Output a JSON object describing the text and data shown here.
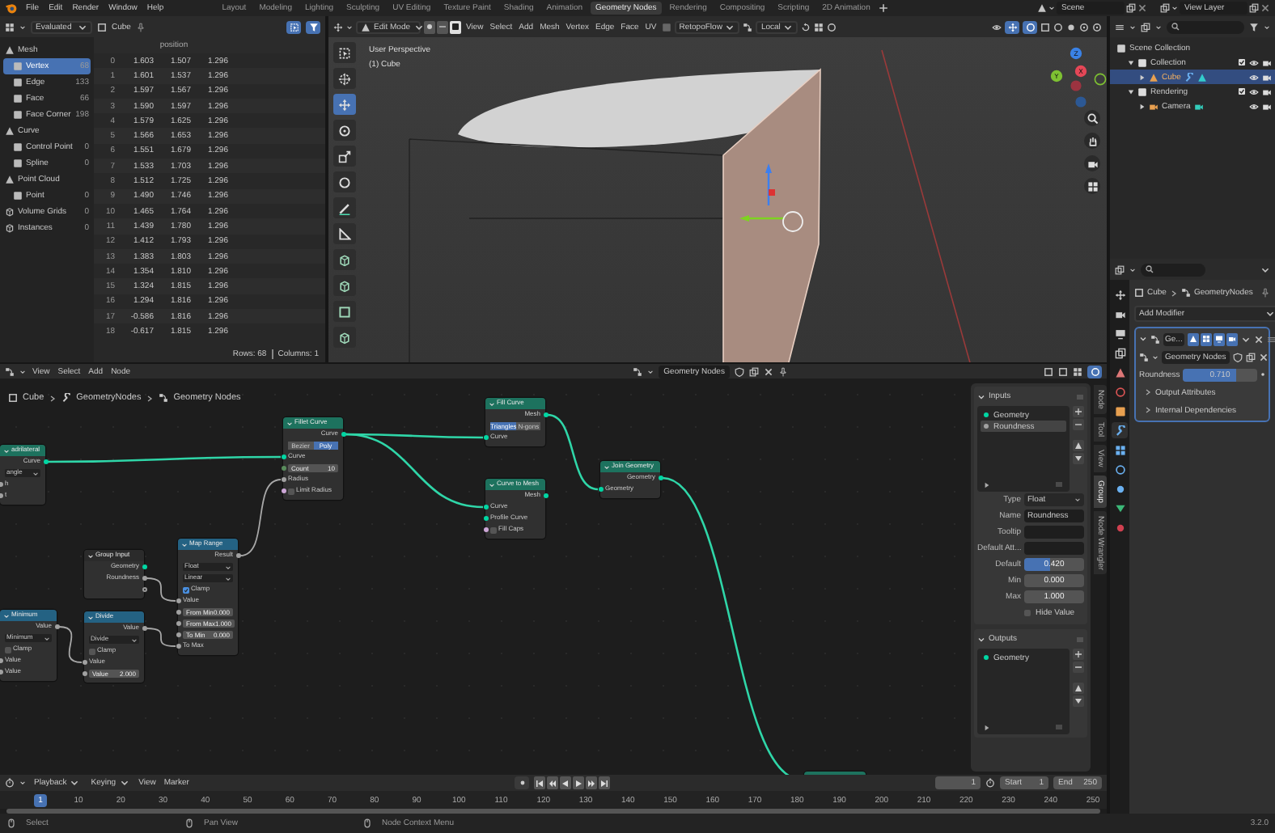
{
  "menubar": {
    "menus": [
      "File",
      "Edit",
      "Render",
      "Window",
      "Help"
    ],
    "workspaces": [
      {
        "label": "Layout",
        "selected": false
      },
      {
        "label": "Modeling",
        "selected": false
      },
      {
        "label": "Lighting",
        "selected": false
      },
      {
        "label": "Sculpting",
        "selected": false
      },
      {
        "label": "UV Editing",
        "selected": false
      },
      {
        "label": "Texture Paint",
        "selected": false
      },
      {
        "label": "Shading",
        "selected": false
      },
      {
        "label": "Animation",
        "selected": false
      },
      {
        "label": "Geometry Nodes",
        "selected": true
      },
      {
        "label": "Rendering",
        "selected": false
      },
      {
        "label": "Compositing",
        "selected": false
      },
      {
        "label": "Scripting",
        "selected": false
      },
      {
        "label": "2D Animation",
        "selected": false
      }
    ],
    "scene": "Scene",
    "view_layer": "View Layer"
  },
  "spreadsheet": {
    "mode": "Evaluated",
    "object": "Cube",
    "domains": [
      {
        "label": "Mesh",
        "children": [
          {
            "label": "Vertex",
            "count": "68",
            "selected": true
          },
          {
            "label": "Edge",
            "count": "133",
            "selected": false
          },
          {
            "label": "Face",
            "count": "66",
            "selected": false
          },
          {
            "label": "Face Corner",
            "count": "198",
            "selected": false
          }
        ]
      },
      {
        "label": "Curve",
        "children": [
          {
            "label": "Control Point",
            "count": "0",
            "selected": false
          },
          {
            "label": "Spline",
            "count": "0",
            "selected": false
          }
        ]
      },
      {
        "label": "Point Cloud",
        "children": [
          {
            "label": "Point",
            "count": "0",
            "selected": false
          }
        ]
      },
      {
        "label": "Volume Grids",
        "count": "0",
        "selected": false
      },
      {
        "label": "Instances",
        "count": "0",
        "selected": false
      }
    ],
    "column": "position",
    "rows": [
      [
        "0",
        "1.603",
        "1.507",
        "1.296"
      ],
      [
        "1",
        "1.601",
        "1.537",
        "1.296"
      ],
      [
        "2",
        "1.597",
        "1.567",
        "1.296"
      ],
      [
        "3",
        "1.590",
        "1.597",
        "1.296"
      ],
      [
        "4",
        "1.579",
        "1.625",
        "1.296"
      ],
      [
        "5",
        "1.566",
        "1.653",
        "1.296"
      ],
      [
        "6",
        "1.551",
        "1.679",
        "1.296"
      ],
      [
        "7",
        "1.533",
        "1.703",
        "1.296"
      ],
      [
        "8",
        "1.512",
        "1.725",
        "1.296"
      ],
      [
        "9",
        "1.490",
        "1.746",
        "1.296"
      ],
      [
        "10",
        "1.465",
        "1.764",
        "1.296"
      ],
      [
        "11",
        "1.439",
        "1.780",
        "1.296"
      ],
      [
        "12",
        "1.412",
        "1.793",
        "1.296"
      ],
      [
        "13",
        "1.383",
        "1.803",
        "1.296"
      ],
      [
        "14",
        "1.354",
        "1.810",
        "1.296"
      ],
      [
        "15",
        "1.324",
        "1.815",
        "1.296"
      ],
      [
        "16",
        "1.294",
        "1.816",
        "1.296"
      ],
      [
        "17",
        "-0.586",
        "1.816",
        "1.296"
      ],
      [
        "18",
        "-0.617",
        "1.815",
        "1.296"
      ]
    ],
    "rows_count": "Rows: 68",
    "columns_count": "Columns: 1"
  },
  "viewport": {
    "mode": "Edit Mode",
    "select_modes": [
      {
        "selected": false
      },
      {
        "selected": false
      },
      {
        "selected": true
      }
    ],
    "menus": [
      "View",
      "Select",
      "Add",
      "Mesh",
      "Vertex",
      "Edge",
      "Face",
      "UV"
    ],
    "addon": "RetopoFlow",
    "orientation": "Local",
    "overlay": [
      "User Perspective",
      "(1) Cube"
    ],
    "tools": [
      {
        "selected": false
      },
      {
        "selected": false
      },
      {
        "selected": true
      },
      {
        "selected": false
      },
      {
        "selected": false
      },
      {
        "selected": false
      },
      {
        "selected": false
      },
      {
        "selected": false
      },
      {
        "selected": false
      },
      {
        "selected": false
      },
      {
        "selected": false
      },
      {
        "selected": false
      }
    ],
    "axes": [
      "Z",
      "X",
      "Y"
    ]
  },
  "node_editor": {
    "menus": [
      "View",
      "Select",
      "Add",
      "Node"
    ],
    "node_group": "Geometry Nodes",
    "breadcrumb": [
      "Cube",
      "GeometryNodes",
      "Geometry Nodes"
    ],
    "nodes": [
      {
        "title": "adrilateral",
        "color": "#1d725e",
        "rows": [
          {
            "kind": "output",
            "label": "Curve",
            "color": "#00d6a3"
          },
          {
            "kind": "dropdown",
            "value": "angle"
          },
          {
            "kind": "input",
            "label": "h",
            "color": "#a1a1a1"
          },
          {
            "kind": "input",
            "label": "t",
            "color": "#a1a1a1"
          }
        ]
      },
      {
        "title": "Fillet Curve",
        "color": "#1d725e",
        "rows": [
          {
            "kind": "output",
            "label": "Curve",
            "color": "#00d6a3"
          },
          {
            "kind": "toggle",
            "options": [
              {
                "label": "Bezier",
                "selected": false
              },
              {
                "label": "Poly",
                "selected": true
              }
            ]
          },
          {
            "kind": "input",
            "label": "Curve",
            "color": "#00d6a3"
          },
          {
            "kind": "field",
            "label": "Count",
            "value": "10",
            "color": "#598c5c"
          },
          {
            "kind": "input",
            "label": "Radius",
            "color": "#a1a1a1"
          },
          {
            "kind": "checkbox",
            "label": "Limit Radius",
            "checked": false,
            "color": "#cca6d6"
          }
        ]
      },
      {
        "title": "Fill Curve",
        "color": "#1d725e",
        "rows": [
          {
            "kind": "output",
            "label": "Mesh",
            "color": "#00d6a3"
          },
          {
            "kind": "toggle",
            "options": [
              {
                "label": "Triangles",
                "selected": true
              },
              {
                "label": "N-gons",
                "selected": false
              }
            ]
          },
          {
            "kind": "input",
            "label": "Curve",
            "color": "#00d6a3"
          }
        ]
      },
      {
        "title": "Curve to Mesh",
        "color": "#1d725e",
        "rows": [
          {
            "kind": "output",
            "label": "Mesh",
            "color": "#00d6a3"
          },
          {
            "kind": "input",
            "label": "Curve",
            "color": "#00d6a3"
          },
          {
            "kind": "input",
            "label": "Profile Curve",
            "color": "#00d6a3"
          },
          {
            "kind": "checkbox",
            "label": "Fill Caps",
            "checked": false,
            "color": "#cca6d6"
          }
        ]
      },
      {
        "title": "Join Geometry",
        "color": "#1d725e",
        "rows": [
          {
            "kind": "output",
            "label": "Geometry",
            "color": "#00d6a3"
          },
          {
            "kind": "input",
            "label": "Geometry",
            "color": "#00d6a3"
          }
        ]
      },
      {
        "title": "Group Input",
        "color": "#2b2b2b",
        "rows": [
          {
            "kind": "output",
            "label": "Geometry",
            "color": "#00d6a3"
          },
          {
            "kind": "output",
            "label": "Roundness",
            "color": "#a1a1a1"
          },
          {
            "kind": "output"
          }
        ]
      },
      {
        "title": "Map Range",
        "color": "#246283",
        "rows": [
          {
            "kind": "output",
            "label": "Result",
            "color": "#a1a1a1"
          },
          {
            "kind": "dropdown",
            "value": "Float"
          },
          {
            "kind": "dropdown",
            "value": "Linear"
          },
          {
            "kind": "checkbox",
            "label": "Clamp",
            "checked": true
          },
          {
            "kind": "input",
            "label": "Value",
            "color": "#a1a1a1"
          },
          {
            "kind": "field",
            "label": "From Min",
            "value": "0.000",
            "color": "#a1a1a1"
          },
          {
            "kind": "field",
            "label": "From Max",
            "value": "1.000",
            "color": "#a1a1a1"
          },
          {
            "kind": "field",
            "label": "To Min",
            "value": "0.000",
            "color": "#a1a1a1"
          },
          {
            "kind": "input",
            "label": "To Max",
            "color": "#a1a1a1"
          }
        ]
      },
      {
        "title": "Minimum",
        "color": "#246283",
        "rows": [
          {
            "kind": "output",
            "label": "Value",
            "color": "#a1a1a1"
          },
          {
            "kind": "dropdown",
            "value": "Minimum"
          },
          {
            "kind": "checkbox",
            "label": "Clamp",
            "checked": false
          },
          {
            "kind": "input",
            "label": "Value",
            "color": "#a1a1a1"
          },
          {
            "kind": "input",
            "label": "Value",
            "color": "#a1a1a1"
          }
        ]
      },
      {
        "title": "Divide",
        "color": "#246283",
        "rows": [
          {
            "kind": "output",
            "label": "Value",
            "color": "#a1a1a1"
          },
          {
            "kind": "dropdown",
            "value": "Divide"
          },
          {
            "kind": "checkbox",
            "label": "Clamp",
            "checked": false
          },
          {
            "kind": "input",
            "label": "Value",
            "color": "#a1a1a1"
          },
          {
            "kind": "field",
            "label": "Value",
            "value": "2.000",
            "color": "#a1a1a1"
          }
        ]
      },
      {
        "color": "#1d725e"
      }
    ]
  },
  "group_panel": {
    "tabs": [
      {
        "label": "Node",
        "selected": false
      },
      {
        "label": "Tool",
        "selected": false
      },
      {
        "label": "View",
        "selected": false
      },
      {
        "label": "Group",
        "selected": true
      },
      {
        "label": "Node Wrangler",
        "selected": false
      }
    ],
    "inputs": {
      "title": "Inputs",
      "expanded": true,
      "items": [
        {
          "label": "Geometry",
          "selected": false,
          "color": "#00d6a3"
        },
        {
          "label": "Roundness",
          "selected": true,
          "color": "#a1a1a1"
        }
      ]
    },
    "fields": [
      {
        "kind": "dropdown",
        "label": "Type",
        "value": "Float"
      },
      {
        "kind": "text",
        "label": "Name",
        "value": "Roundness"
      },
      {
        "kind": "text",
        "label": "Tooltip"
      },
      {
        "kind": "text",
        "label": "Default Att..."
      },
      {
        "kind": "slider",
        "label": "Default",
        "value": "0.420",
        "level": 0.42
      },
      {
        "kind": "number",
        "label": "Min",
        "value": "0.000"
      },
      {
        "kind": "number",
        "label": "Max",
        "value": "1.000"
      },
      {
        "kind": "checkbox",
        "label": "Hide Value",
        "checked": false
      }
    ],
    "outputs": {
      "title": "Outputs",
      "expanded": true,
      "items": [
        {
          "label": "Geometry",
          "selected": false,
          "color": "#00d6a3"
        }
      ]
    }
  },
  "outliner": {
    "items": [
      {
        "label": "Scene Collection",
        "kind": "scene",
        "selected": false,
        "children": [
          {
            "label": "Collection",
            "kind": "collection",
            "expanded": true,
            "selected": false,
            "children": [
              {
                "label": "Cube",
                "kind": "object",
                "expanded": false,
                "selected": true
              }
            ]
          },
          {
            "label": "Rendering",
            "kind": "collection",
            "expanded": true,
            "selected": false,
            "children": [
              {
                "label": "Camera",
                "kind": "camera",
                "expanded": false,
                "selected": false
              }
            ]
          }
        ]
      }
    ]
  },
  "properties": {
    "tabs": [
      {
        "selected": false
      },
      {
        "selected": false
      },
      {
        "selected": false
      },
      {
        "selected": false
      },
      {
        "selected": false
      },
      {
        "selected": false
      },
      {
        "selected": false
      },
      {
        "selected": true
      },
      {
        "selected": false
      },
      {
        "selected": false
      },
      {
        "selected": false
      },
      {
        "selected": false
      },
      {
        "selected": false
      }
    ],
    "breadcrumb": [
      "Cube",
      "GeometryNodes"
    ],
    "add_modifier": "Add Modifier",
    "modifier": {
      "name": "Ge...",
      "expanded": true,
      "node_group": "Geometry Nodes",
      "inputs": [
        {
          "label": "Roundness",
          "value": "0.710",
          "level": 0.71
        }
      ],
      "panels": [
        {
          "label": "Output Attributes",
          "expanded": false
        },
        {
          "label": "Internal Dependencies",
          "expanded": false
        }
      ]
    }
  },
  "timeline": {
    "menus": [
      {
        "label": "Playback",
        "kind": "dropdown"
      },
      {
        "label": "Keying",
        "kind": "dropdown"
      },
      {
        "label": "View",
        "kind": "menu"
      },
      {
        "label": "Marker",
        "kind": "menu"
      }
    ],
    "current_frame": "1",
    "start_label": "Start",
    "start": "1",
    "end_label": "End",
    "end": "250",
    "ruler": [
      {
        "label": "1",
        "selected": true
      },
      {
        "label": "10",
        "selected": false
      },
      {
        "label": "20",
        "selected": false
      },
      {
        "label": "30",
        "selected": false
      },
      {
        "label": "40",
        "selected": false
      },
      {
        "label": "50",
        "selected": false
      },
      {
        "label": "60",
        "selected": false
      },
      {
        "label": "70",
        "selected": false
      },
      {
        "label": "80",
        "selected": false
      },
      {
        "label": "90",
        "selected": false
      },
      {
        "label": "100",
        "selected": false
      },
      {
        "label": "110",
        "selected": false
      },
      {
        "label": "120",
        "selected": false
      },
      {
        "label": "130",
        "selected": false
      },
      {
        "label": "140",
        "selected": false
      },
      {
        "label": "150",
        "selected": false
      },
      {
        "label": "160",
        "selected": false
      },
      {
        "label": "170",
        "selected": false
      },
      {
        "label": "180",
        "selected": false
      },
      {
        "label": "190",
        "selected": false
      },
      {
        "label": "200",
        "selected": false
      },
      {
        "label": "210",
        "selected": false
      },
      {
        "label": "220",
        "selected": false
      },
      {
        "label": "230",
        "selected": false
      },
      {
        "label": "240",
        "selected": false
      },
      {
        "label": "250",
        "selected": false
      }
    ]
  },
  "status_bar": {
    "hints": [
      "Select",
      "Pan View",
      "Node Context Menu"
    ],
    "version": "3.2.0"
  }
}
